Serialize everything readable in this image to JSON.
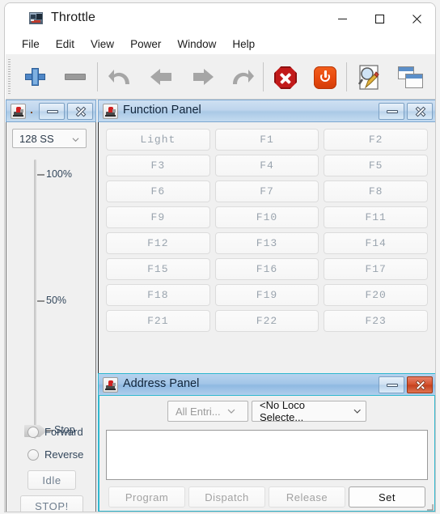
{
  "window": {
    "title": "Throttle",
    "icon": "locomotive-icon",
    "minimize": "–",
    "maximize": "□",
    "close": "✕"
  },
  "menubar": {
    "items": [
      {
        "label": "File"
      },
      {
        "label": "Edit"
      },
      {
        "label": "View"
      },
      {
        "label": "Power"
      },
      {
        "label": "Window"
      },
      {
        "label": "Help"
      }
    ]
  },
  "toolbar": {
    "buttons": [
      {
        "name": "new-throttle-icon",
        "icon": "plus-icon",
        "enabled": true
      },
      {
        "name": "remove-throttle-icon",
        "icon": "minus-icon",
        "enabled": false
      },
      {
        "name": "undo-icon",
        "icon": "undo-arrow-icon",
        "enabled": false
      },
      {
        "name": "back-icon",
        "icon": "left-arrow-icon",
        "enabled": false
      },
      {
        "name": "forward-icon",
        "icon": "right-arrow-icon",
        "enabled": false
      },
      {
        "name": "redo-icon",
        "icon": "redo-arrow-icon",
        "enabled": false
      },
      {
        "name": "estop-icon",
        "icon": "stop-sign-icon",
        "enabled": true
      },
      {
        "name": "power-icon",
        "icon": "power-button-icon",
        "enabled": true
      },
      {
        "name": "edit-roster-icon",
        "icon": "document-magnifier-pencil-icon",
        "enabled": true
      },
      {
        "name": "windows-icon",
        "icon": "cascade-windows-icon",
        "enabled": true
      }
    ]
  },
  "throttle_panel": {
    "title": "",
    "title_dot": ".",
    "speed_step_mode": "128 SS",
    "slider": {
      "ticks": [
        {
          "label": "100%",
          "value": 100
        },
        {
          "label": "50%",
          "value": 50
        },
        {
          "label": "Stop",
          "value": 0
        }
      ],
      "current_value": 0
    },
    "direction": [
      {
        "label": "Forward",
        "selected": false
      },
      {
        "label": "Reverse",
        "selected": false
      }
    ],
    "idle_label": "Idle",
    "stop_label": "STOP!"
  },
  "function_panel": {
    "title": "Function Panel",
    "buttons": [
      "Light",
      "F1",
      "F2",
      "F3",
      "F4",
      "F5",
      "F6",
      "F7",
      "F8",
      "F9",
      "F10",
      "F11",
      "F12",
      "F13",
      "F14",
      "F15",
      "F16",
      "F17",
      "F18",
      "F19",
      "F20",
      "F21",
      "F22",
      "F23"
    ]
  },
  "address_panel": {
    "title": "Address Panel",
    "roster_filter": "All Entri...",
    "loco_select": "<No Loco Selecte...",
    "list_items": [],
    "buttons": [
      {
        "label": "Program",
        "enabled": false
      },
      {
        "label": "Dispatch",
        "enabled": false
      },
      {
        "label": "Release",
        "enabled": false
      },
      {
        "label": "Set",
        "enabled": true
      }
    ]
  },
  "colors": {
    "accent_blue": "#4e86c6",
    "stop_red": "#c21a1a",
    "power_orange": "#e8490e",
    "focus_cyan": "#2fb8cf",
    "title_blue": "#aac9e6"
  }
}
